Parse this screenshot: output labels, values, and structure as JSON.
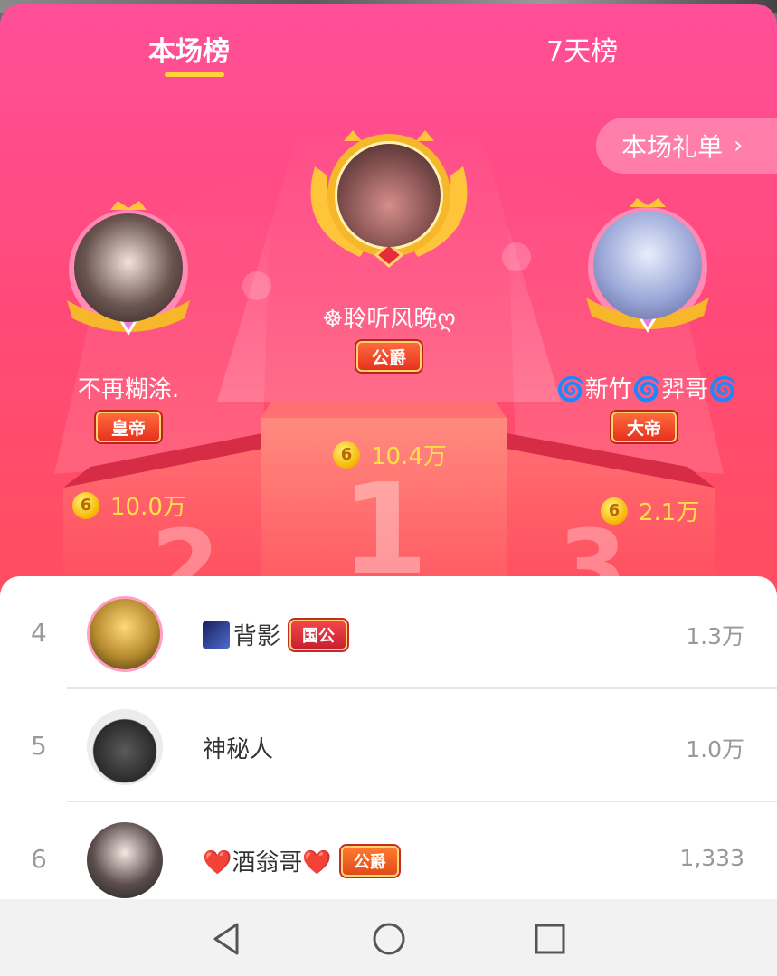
{
  "tabs": [
    {
      "label": "本场榜",
      "active": true
    },
    {
      "label": "7天榜",
      "active": false
    }
  ],
  "gift_list_button": {
    "label": "本场礼单",
    "arrow": "›"
  },
  "podium": {
    "first": {
      "rank": "1",
      "name": "☸聆听风晚ღ",
      "badge": "公爵",
      "coins": "10.4万"
    },
    "second": {
      "rank": "2",
      "name": "不再糊涂.",
      "badge": "皇帝",
      "coins": "10.0万"
    },
    "third": {
      "rank": "3",
      "name": "🌀新竹🌀羿哥🌀",
      "badge": "大帝",
      "coins": "2.1万"
    }
  },
  "coin_symbol": "6",
  "list": [
    {
      "rank": "4",
      "name": "背影",
      "badge": "国公",
      "value": "1.3万"
    },
    {
      "rank": "5",
      "name": "神秘人",
      "badge": "",
      "value": "1.0万"
    },
    {
      "rank": "6",
      "name": "❤️酒翁哥❤️",
      "badge": "公爵",
      "value": "1,333"
    }
  ],
  "colors": {
    "panel_top": "#ff4f98",
    "panel_bottom": "#ff3d5a",
    "tab_indicator": "#ffd43b",
    "coin_text": "#ffe04a"
  },
  "navbar": {
    "icons": [
      "back-triangle-icon",
      "home-circle-icon",
      "recents-square-icon"
    ]
  }
}
